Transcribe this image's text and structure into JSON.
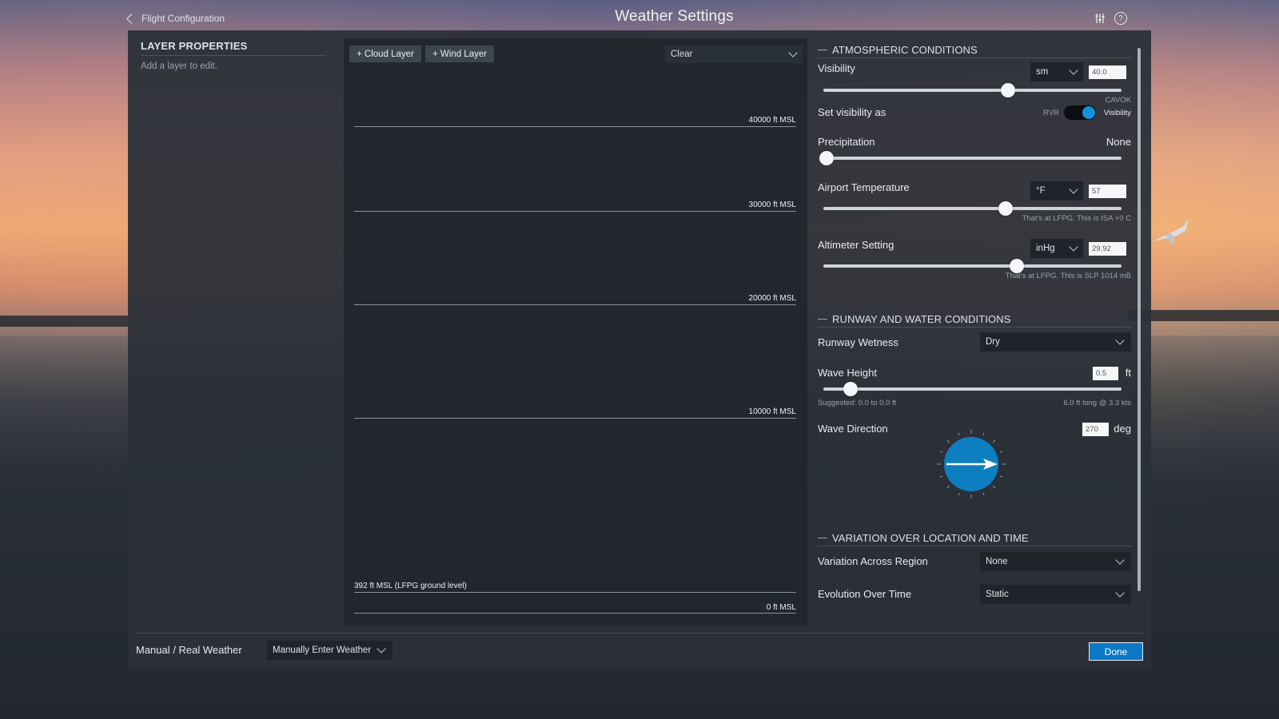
{
  "header": {
    "back_label": "Flight Configuration",
    "title": "Weather Settings"
  },
  "layer_properties": {
    "title": "LAYER PROPERTIES",
    "hint": "Add a layer to edit."
  },
  "graph": {
    "add_cloud_label": "+ Cloud Layer",
    "add_wind_label": "+ Wind Layer",
    "preset_value": "Clear",
    "altitude_labels": [
      "40000 ft MSL",
      "30000 ft MSL",
      "20000 ft MSL",
      "10000 ft MSL",
      "0 ft MSL"
    ],
    "ground_label": "392 ft MSL (LFPG ground level)"
  },
  "atmospheric": {
    "title": "ATMOSPHERIC CONDITIONS",
    "visibility": {
      "label": "Visibility",
      "unit": "sm",
      "value": "40.0",
      "fraction": 0.62,
      "note": "CAVOK"
    },
    "set_visibility": {
      "label": "Set visibility as",
      "left_option": "RVR",
      "right_option": "Visibility"
    },
    "precipitation": {
      "label": "Precipitation",
      "value": "None",
      "fraction": 0.01
    },
    "temperature": {
      "label": "Airport Temperature",
      "unit": "°F",
      "value": "57",
      "fraction": 0.61,
      "note": "That's at LFPG. This is ISA +0 C"
    },
    "altimeter": {
      "label": "Altimeter Setting",
      "unit": "inHg",
      "value": "29.92",
      "fraction": 0.65,
      "note": "That's at LFPG. This is SLP 1014 mB"
    }
  },
  "runway_water": {
    "title": "RUNWAY AND WATER CONDITIONS",
    "runway_wetness": {
      "label": "Runway Wetness",
      "value": "Dry"
    },
    "wave_height": {
      "label": "Wave Height",
      "value": "0.5",
      "unit": "ft",
      "fraction": 0.09,
      "suggested": "Suggested: 0.0 to 0.0 ft",
      "wave_info": "6.0 ft long @ 3.3 kts"
    },
    "wave_direction": {
      "label": "Wave Direction",
      "value": "270",
      "unit": "deg"
    }
  },
  "variation": {
    "title": "VARIATION OVER LOCATION AND TIME",
    "region": {
      "label": "Variation Across Region",
      "value": "None"
    },
    "evolution": {
      "label": "Evolution Over Time",
      "value": "Static"
    }
  },
  "bottom": {
    "mode_label": "Manual / Real Weather",
    "mode_value": "Manually Enter Weather",
    "done_label": "Done"
  },
  "colors": {
    "accent": "#0b79c5",
    "toggle": "#1591d9",
    "panel_bg": "#2a3038"
  }
}
